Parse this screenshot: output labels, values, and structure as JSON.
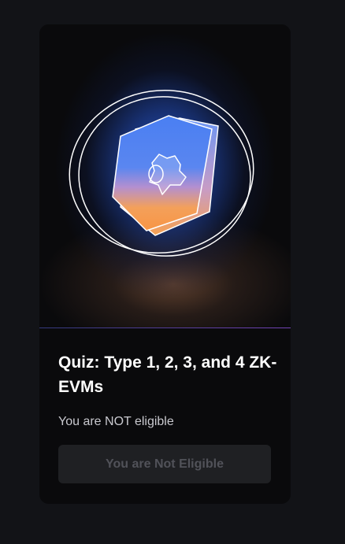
{
  "quiz_card": {
    "title": "Quiz: Type 1, 2, 3, and 4 ZK-EVMs",
    "eligibility_text": "You are NOT eligible",
    "button_label": "You are Not Eligible",
    "badge_icon": "hexagon-badge-icon",
    "colors": {
      "page_background": "#121317",
      "card_background": "#0a0a0c",
      "badge_blue": "#4f7ff0",
      "badge_orange": "#f6a14f",
      "button_background": "#1f2023",
      "button_text": "#515259"
    }
  }
}
